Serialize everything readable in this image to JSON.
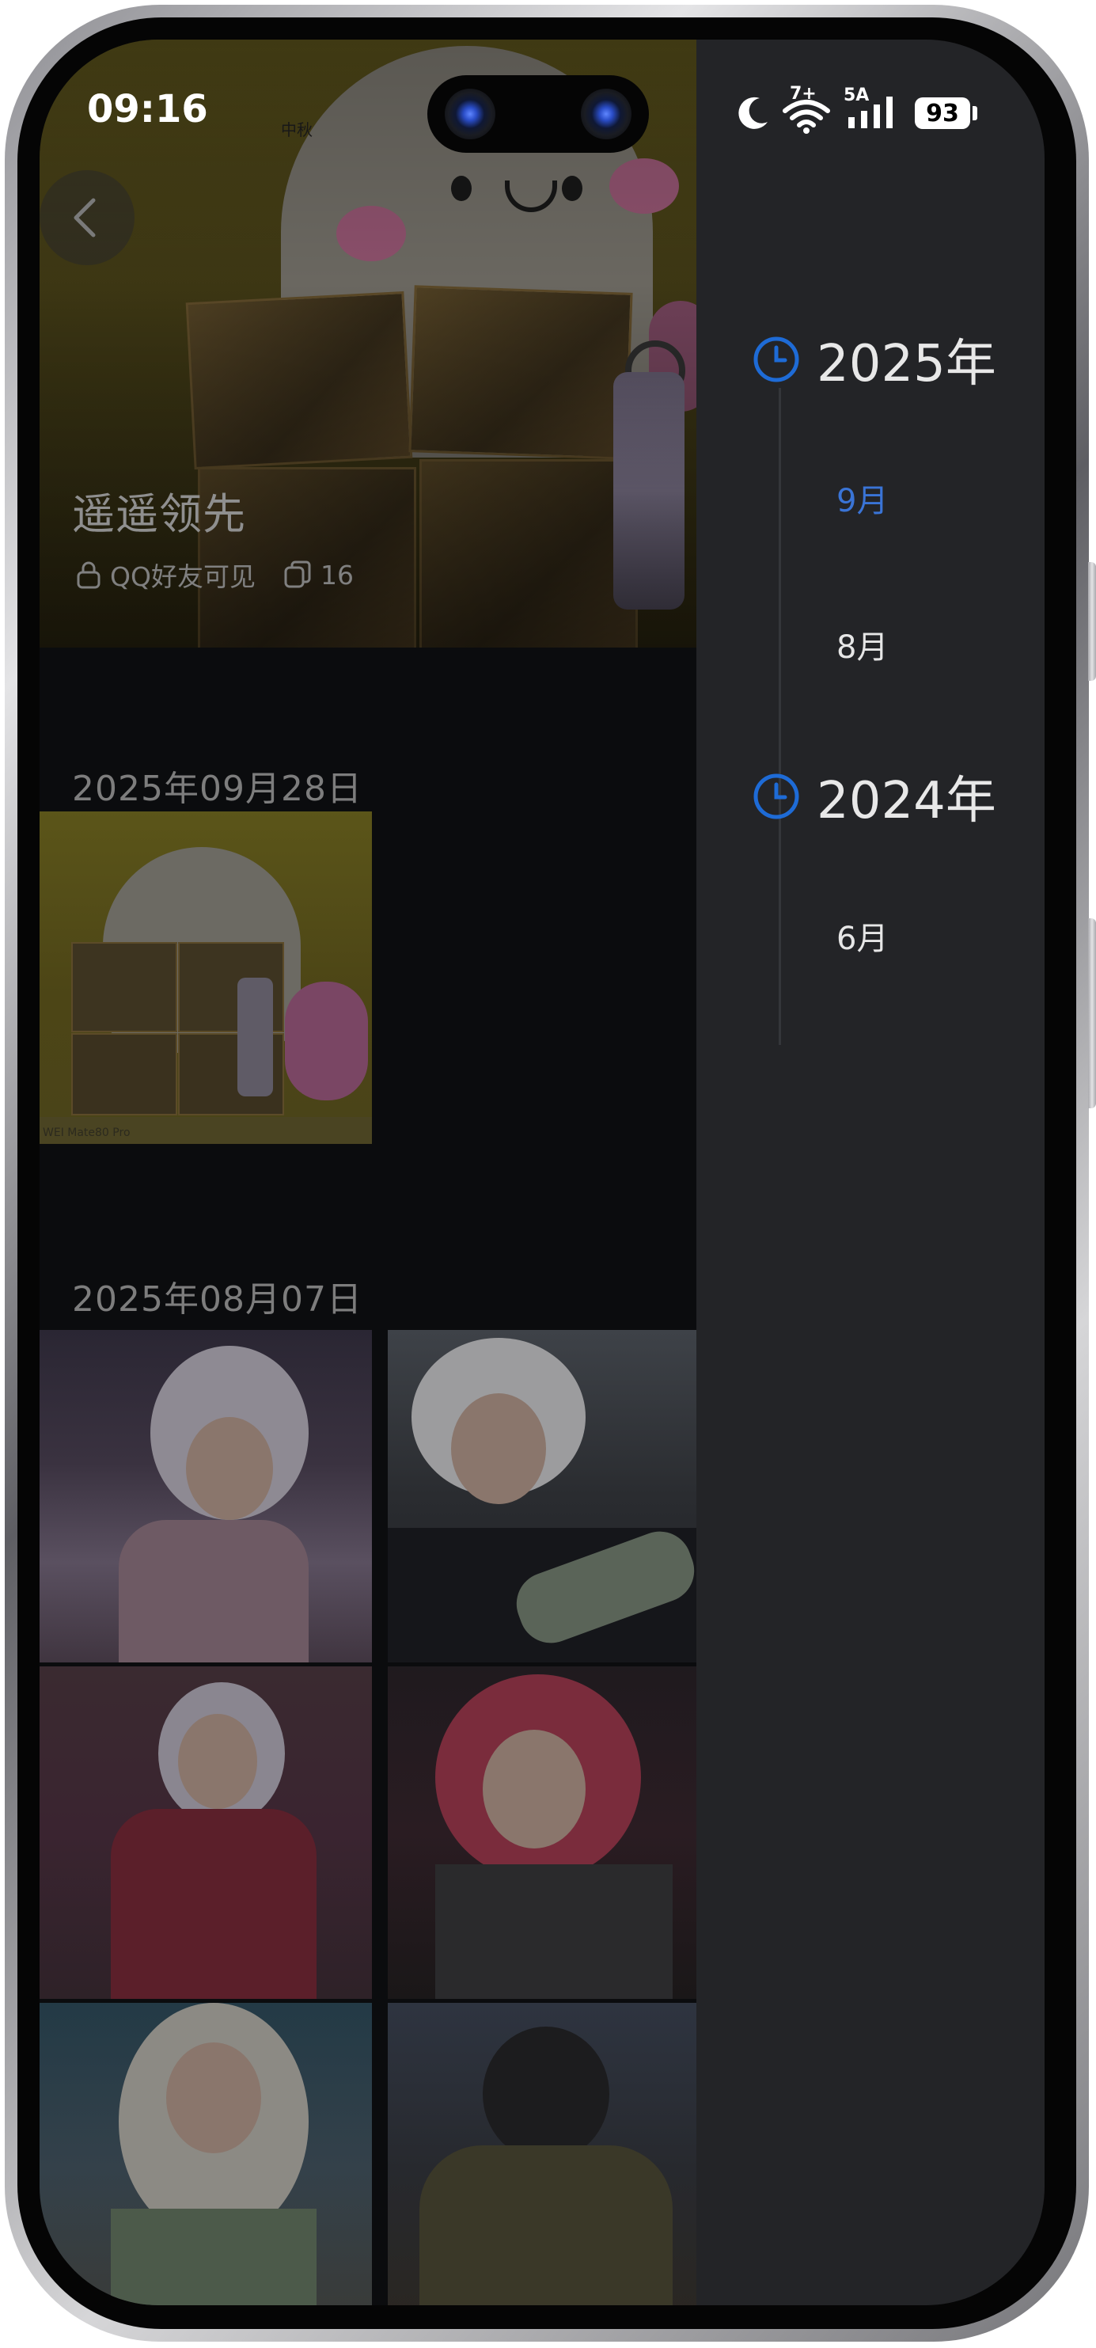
{
  "status_bar": {
    "time": "09:16",
    "wifi_badge": "7+",
    "network_type": "5A",
    "battery": "93",
    "icons": [
      "moon-icon",
      "wifi-icon",
      "signal-icon",
      "battery-icon"
    ]
  },
  "album": {
    "title": "遥遥领先",
    "cover_tag": "中秋",
    "privacy_label": "QQ好友可见",
    "photo_count": "16",
    "sections": [
      {
        "date": "2025年09月28日",
        "photo_count": 1
      },
      {
        "date": "2025年08月07日",
        "photo_count": 6
      }
    ],
    "thumb_footer_text": "WEI Mate80 Pro"
  },
  "timeline": {
    "years": [
      {
        "label": "2025年",
        "months": [
          {
            "label": "9月",
            "active": true
          },
          {
            "label": "8月",
            "active": false
          }
        ]
      },
      {
        "label": "2024年",
        "months": [
          {
            "label": "6月",
            "active": false
          }
        ]
      }
    ]
  },
  "colors": {
    "accent": "#1e6bd6",
    "active_month": "#3a74d6",
    "timeline_bg": "#232427",
    "album_bg": "#0b0c0e"
  }
}
